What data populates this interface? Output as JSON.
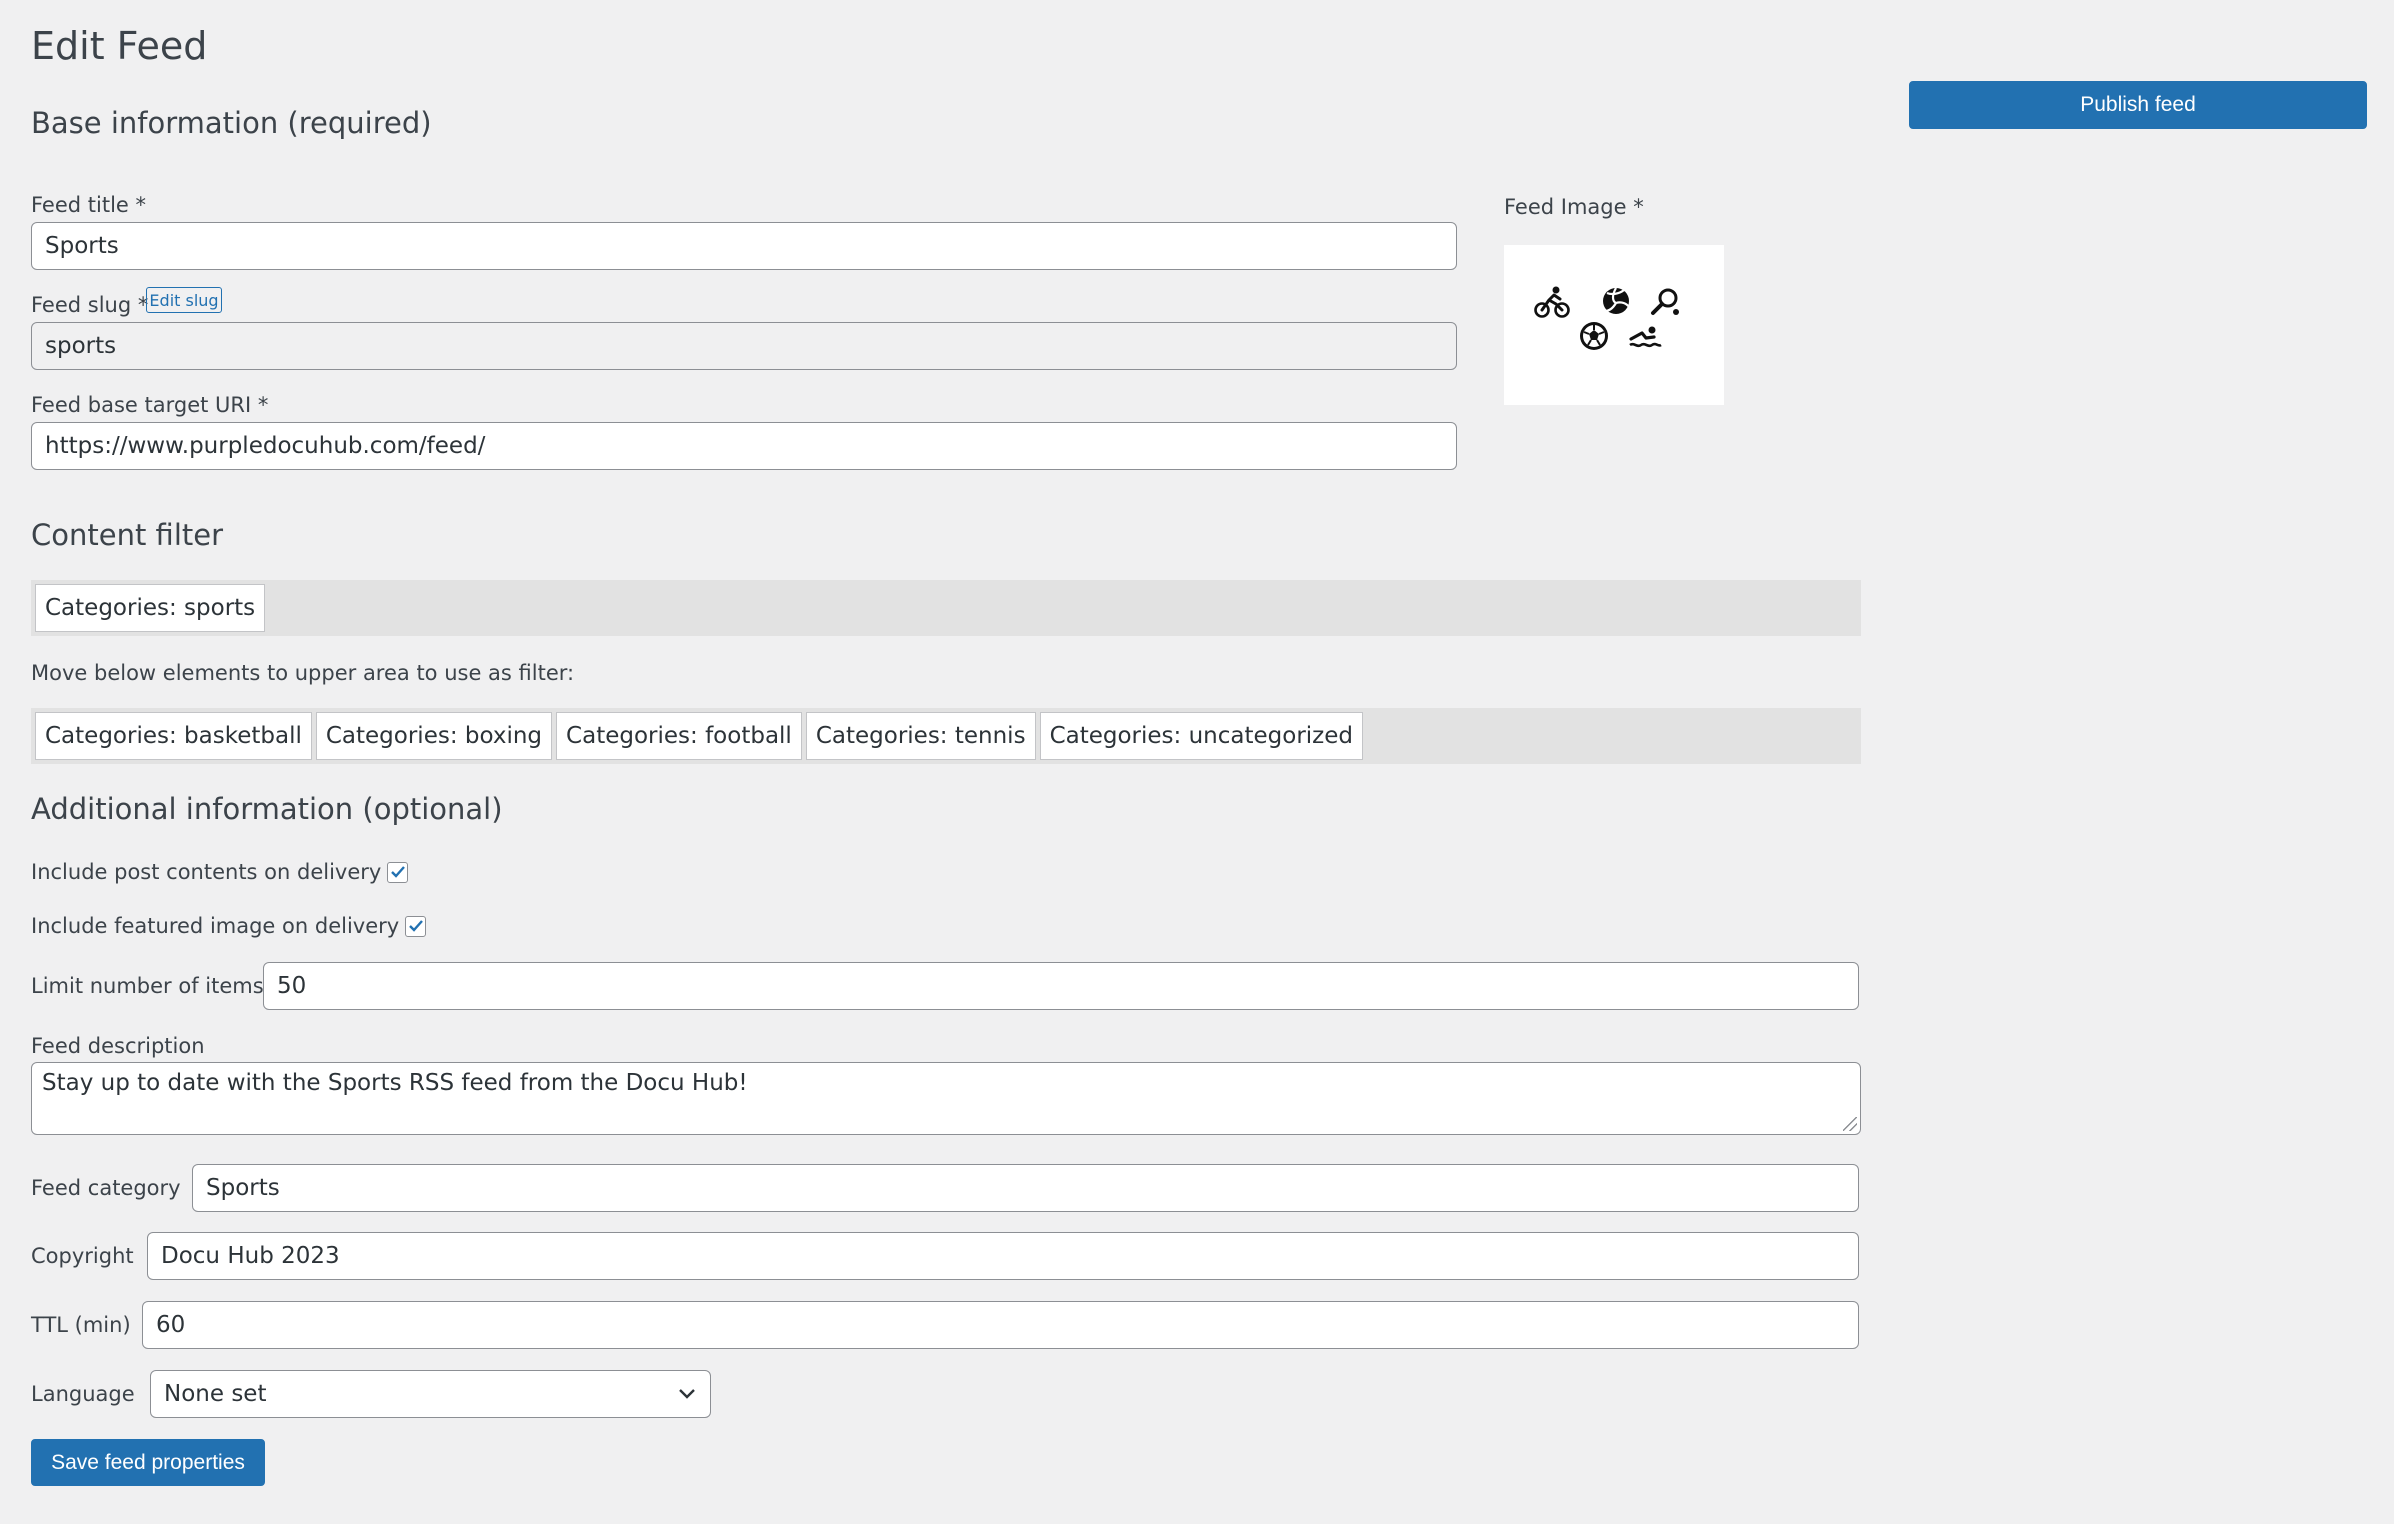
{
  "page": {
    "title": "Edit Feed"
  },
  "publish": {
    "label": "Publish feed"
  },
  "base_info": {
    "heading": "Base information (required)",
    "feed_title": {
      "label": "Feed title *",
      "value": "Sports"
    },
    "feed_slug": {
      "label": "Feed slug *",
      "edit_label": "Edit slug",
      "value": "sports"
    },
    "feed_uri": {
      "label": "Feed base target URI *",
      "value": "https://www.purpledocuhub.com/feed/"
    },
    "feed_image": {
      "label": "Feed Image *",
      "icons": [
        "cycling-icon",
        "volleyball-icon",
        "tennis-racket-icon",
        "soccer-ball-icon",
        "swimming-icon"
      ]
    }
  },
  "content_filter": {
    "heading": "Content filter",
    "active": [
      "Categories: sports"
    ],
    "instruction": "Move below elements to upper area to use as filter:",
    "available": [
      "Categories: basketball",
      "Categories: boxing",
      "Categories: football",
      "Categories: tennis",
      "Categories: uncategorized"
    ]
  },
  "additional": {
    "heading": "Additional information (optional)",
    "include_contents": {
      "label": "Include post contents on delivery",
      "checked": true
    },
    "include_image": {
      "label": "Include featured image on delivery",
      "checked": true
    },
    "limit": {
      "label": "Limit number of items",
      "value": "50"
    },
    "description": {
      "label": "Feed description",
      "value": "Stay up to date with the Sports RSS feed from the Docu Hub!"
    },
    "category": {
      "label": "Feed category",
      "value": "Sports"
    },
    "copyright": {
      "label": "Copyright",
      "value": "Docu Hub 2023"
    },
    "ttl": {
      "label": "TTL (min)",
      "value": "60"
    },
    "language": {
      "label": "Language",
      "value": "None set"
    }
  },
  "save": {
    "label": "Save feed properties"
  },
  "colors": {
    "accent": "#2271b1",
    "background": "#f0f0f1",
    "text": "#3c434a"
  }
}
